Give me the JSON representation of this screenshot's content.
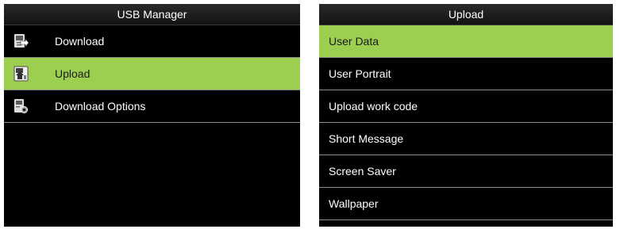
{
  "left_screen": {
    "title": "USB Manager",
    "items": [
      {
        "label": "Download",
        "icon": "download-icon",
        "selected": false
      },
      {
        "label": "Upload",
        "icon": "upload-icon",
        "selected": true
      },
      {
        "label": "Download Options",
        "icon": "download-options-icon",
        "selected": false
      }
    ]
  },
  "right_screen": {
    "title": "Upload",
    "items": [
      {
        "label": "User Data",
        "selected": true
      },
      {
        "label": "User Portrait",
        "selected": false
      },
      {
        "label": "Upload work code",
        "selected": false
      },
      {
        "label": "Short Message",
        "selected": false
      },
      {
        "label": "Screen Saver",
        "selected": false
      },
      {
        "label": "Wallpaper",
        "selected": false
      }
    ]
  },
  "colors": {
    "highlight": "#9ccf50",
    "screen_background": "#000000",
    "text": "#ffffff",
    "divider": "#8a8a8a"
  }
}
